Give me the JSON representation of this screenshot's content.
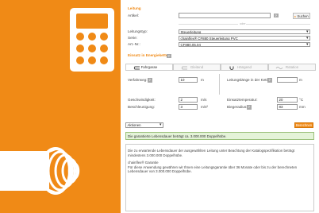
{
  "left_panel": {
    "accent": "#f08a16"
  },
  "leitung": {
    "section_title": "Leitung",
    "artikel_label": "Artikel:",
    "artikel_value": "",
    "search_label": "Suchen",
    "oder_label": "oder",
    "leitungstyp_label": "Leitungstyp:",
    "leitungstyp_value": "Steuerleitung",
    "serie_label": "Serie:",
    "serie_value": "chainflex® CF880 Steuerleitung PVC",
    "artnr_label": "Art.-Nr.:",
    "artnr_value": "CF880.05.04"
  },
  "einsatz": {
    "section_title": "Einsatz in Energiekette",
    "tabs": [
      "Fahrgasse",
      "Gleitend",
      "Hängend",
      "Rotation"
    ],
    "verfahrweg_label": "Verfahrweg:",
    "verfahrweg_value": "10",
    "verfahrweg_unit": "m",
    "leitungslaenge_label": "Leitungslänge in der Kette:",
    "leitungslaenge_value": "",
    "leitungslaenge_unit": "m",
    "geschwindigkeit_label": "Geschwindigkeit:",
    "geschwindigkeit_value": "2",
    "geschwindigkeit_unit": "m/s",
    "beschleunigung_label": "Beschleunigung:",
    "beschleunigung_value": "3",
    "beschleunigung_unit": "m/s²",
    "temperatur_label": "Einsatztemperatur:",
    "temperatur_value": "20",
    "temperatur_unit": "°C",
    "biegeradius_label": "Biegeradius:",
    "biegeradius_value": "83",
    "biegeradius_unit": "mm"
  },
  "result": {
    "mode_value": "Aktionen",
    "berechnen_label": "Berechnen",
    "garantie_text": "Die garantierte Lebensdauer beträgt ca. 3.000.000 Doppelhübe.",
    "info_para1": "Die zu erwartende Lebensdauer der ausgewählten Leitung unter Beachtung der Katalogspezifikation beträgt mindestens 3.000.000 Doppelhübe.",
    "info_para2_title": "chainflex® Garantie",
    "info_para2": "Für diese Anwendung gewähren wir Ihnen eine Leitungsgarantie über 36 Monate oder bis zu der berechneten Lebensdauer von 3.000.000 Doppelhübe."
  }
}
